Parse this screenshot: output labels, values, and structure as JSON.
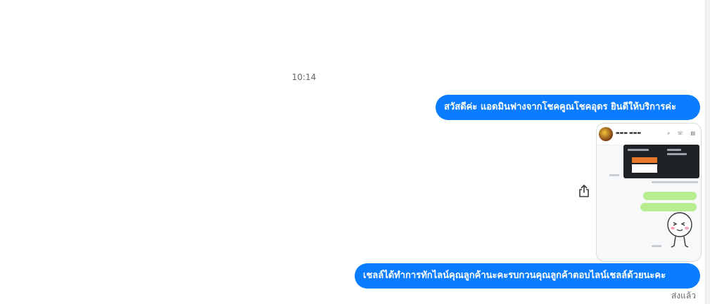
{
  "conversation": {
    "timestamp": "10:14",
    "messages": [
      {
        "type": "text",
        "text": "สวัสดีค่ะ แอดมินฟางจากโชคคูณโชคอุดร ยินดีให้บริการค่ะ"
      },
      {
        "type": "image",
        "description_name": "screenshot-image"
      },
      {
        "type": "text",
        "text": "เชลล์ได้ทำการทักไลน์คุณลูกค้านะคะรบกวนคุณลูกค้าตอบไลน์เชลล์ด้วยนะคะ"
      }
    ],
    "status": "ส่งแล้ว"
  },
  "icons": {
    "share": "share-icon"
  },
  "colors": {
    "bubble": "#0a7cff",
    "bubble_text": "#ffffff",
    "meta_text": "#65676b"
  }
}
